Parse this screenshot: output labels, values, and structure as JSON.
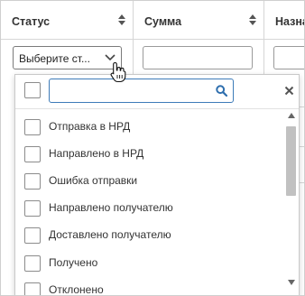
{
  "table": {
    "columns": [
      {
        "label": "Статус"
      },
      {
        "label": "Сумма"
      },
      {
        "label": "Назнач"
      }
    ]
  },
  "filter": {
    "status_select_value": "Выберите ст..."
  },
  "dropdown": {
    "search_value": "",
    "options": [
      {
        "label": "Отправка в НРД",
        "checked": false
      },
      {
        "label": "Направлено в НРД",
        "checked": false
      },
      {
        "label": "Ошибка отправки",
        "checked": false
      },
      {
        "label": "Направлено получателю",
        "checked": false
      },
      {
        "label": "Доставлено получателю",
        "checked": false
      },
      {
        "label": "Получено",
        "checked": false
      },
      {
        "label": "Отклонено",
        "checked": false
      }
    ]
  },
  "colors": {
    "search_border": "#3d7bb8",
    "search_icon": "#2f6fae",
    "scroll_thumb": "#c1c1c1"
  }
}
